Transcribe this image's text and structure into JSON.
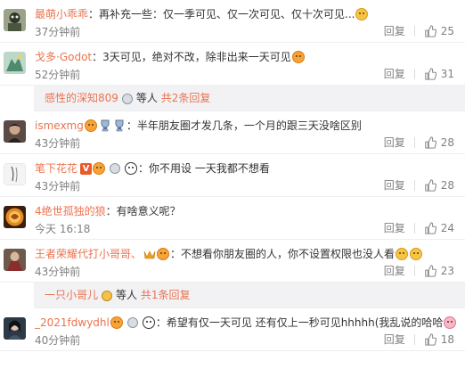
{
  "comments": [
    {
      "username": "最萌小乖乖",
      "separator": "：",
      "text": "再补充一些：仅一季可见、仅一次可见、仅十次可见...",
      "time": "37分钟前",
      "reply_label": "回复",
      "likes": "25",
      "avatar_color": "#7a8a6a"
    },
    {
      "username": "戈多·Godot",
      "separator": "：",
      "text": "3天可见，绝对不改，除非出来一天可见",
      "time": "52分钟前",
      "reply_label": "回复",
      "likes": "31",
      "avatar_color": "#6aa08a"
    },
    {
      "username": "ismexmg",
      "separator": "：",
      "text": "半年朋友圈才发几条，一个月的跟三天没啥区别",
      "time": "43分钟前",
      "reply_label": "回复",
      "likes": "28",
      "avatar_color": "#6b5a55"
    },
    {
      "username": "笔下花花",
      "separator": "：",
      "text": "你不用设 一天我都不想看",
      "time": "43分钟前",
      "reply_label": "回复",
      "likes": "28",
      "avatar_color": "#e8e8e8"
    },
    {
      "username": "4绝世孤独的狼",
      "separator": "：",
      "text": "有啥意义呢？",
      "time": "今天 16:18",
      "reply_label": "回复",
      "likes": "24",
      "avatar_color": "#d4701a"
    },
    {
      "username": "王者荣耀代打小哥哥、",
      "separator": "：",
      "text": "不想看你朋友圈的人，你不设置权限也没人看",
      "time": "43分钟前",
      "reply_label": "回复",
      "likes": "23",
      "avatar_color": "#8a6f5a"
    },
    {
      "username": "_2021fdwydhl",
      "separator": "：",
      "text": "希望有仅一天可见 还有仅上一秒可见hhhhh(我乱说的哈哈",
      "time": "40分钟前",
      "reply_label": "回复",
      "likes": "18",
      "avatar_color": "#3a4a5a"
    }
  ],
  "subreplies": [
    {
      "name": "感性的深知809",
      "middle": "等人",
      "count": "共2条回复"
    },
    {
      "name": "一只小哥儿",
      "middle": "等人",
      "count": "共1条回复"
    }
  ],
  "colors": {
    "username": "#eb7350",
    "meta": "#808080",
    "subbar_bg": "#f2f2f5"
  }
}
